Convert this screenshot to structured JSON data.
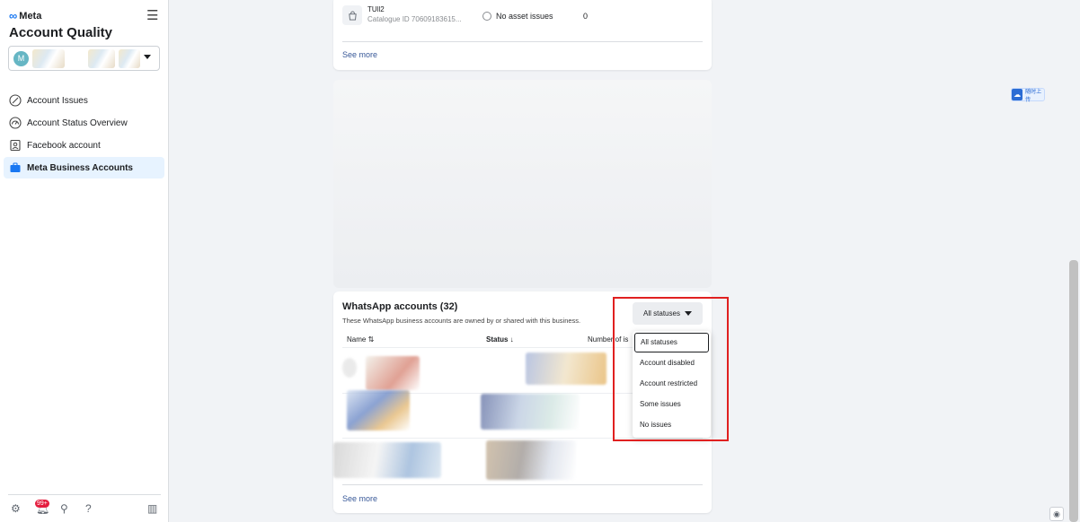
{
  "sidebar": {
    "brand": "Meta",
    "title": "Account Quality",
    "account_initial": "M",
    "nav": [
      {
        "label": "Account Issues",
        "icon": "circle-slash-icon"
      },
      {
        "label": "Account Status Overview",
        "icon": "gauge-icon"
      },
      {
        "label": "Facebook account",
        "icon": "id-badge-icon"
      },
      {
        "label": "Meta Business Accounts",
        "icon": "briefcase-icon",
        "active": true
      }
    ],
    "footer": {
      "notification_badge": "99+"
    }
  },
  "catalog_card": {
    "name": "TUll2",
    "catalogue_id": "Catalogue ID 70609183615...",
    "asset_status": "No asset issues",
    "count": "0",
    "see_more": "See more"
  },
  "whatsapp_card": {
    "title": "WhatsApp accounts (32)",
    "subtitle": "These WhatsApp business accounts are owned by or shared with this business.",
    "filter_label": "All statuses",
    "columns": {
      "name": "Name ⇅",
      "status": "Status ↓",
      "issues": "Number of is"
    },
    "see_more": "See more"
  },
  "status_dropdown": {
    "options": [
      "All statuses",
      "Account disabled",
      "Account restricted",
      "Some issues",
      "No issues"
    ],
    "selected": "All statuses"
  },
  "widget": {
    "upload_label": "随时上传"
  },
  "colors": {
    "accent": "#1877f2",
    "highlight": "#e02020",
    "active_bg": "#e7f3ff"
  }
}
